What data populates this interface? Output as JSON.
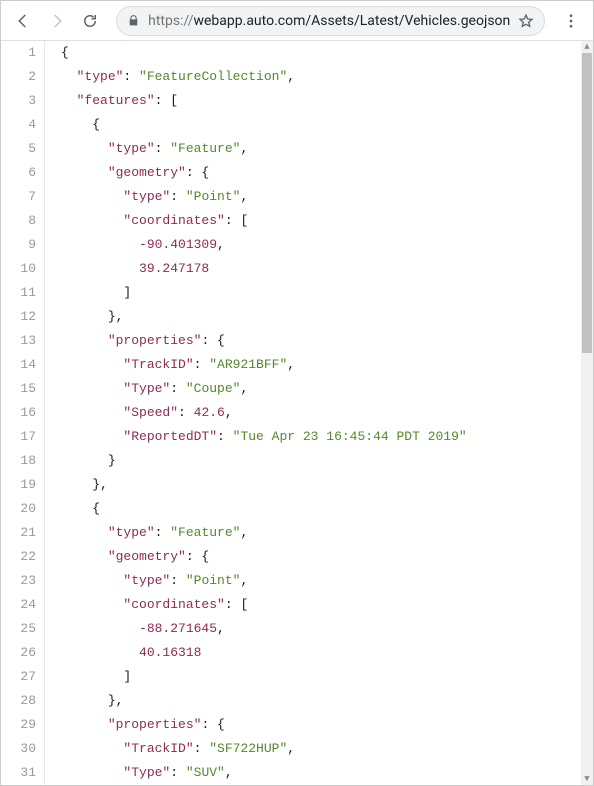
{
  "toolbar": {
    "url_proto": "https://",
    "url_rest": "webapp.auto.com/Assets/Latest/Vehicles.geojson"
  },
  "code": {
    "lines": [
      {
        "n": "1",
        "indent": 0,
        "segs": [
          {
            "c": "punc",
            "t": "{"
          }
        ]
      },
      {
        "n": "2",
        "indent": 1,
        "segs": [
          {
            "c": "key",
            "t": "\"type\""
          },
          {
            "c": "punc",
            "t": ": "
          },
          {
            "c": "str",
            "t": "\"FeatureCollection\""
          },
          {
            "c": "punc",
            "t": ","
          }
        ]
      },
      {
        "n": "3",
        "indent": 1,
        "segs": [
          {
            "c": "key",
            "t": "\"features\""
          },
          {
            "c": "punc",
            "t": ": ["
          }
        ]
      },
      {
        "n": "4",
        "indent": 2,
        "segs": [
          {
            "c": "punc",
            "t": "{"
          }
        ]
      },
      {
        "n": "5",
        "indent": 3,
        "segs": [
          {
            "c": "key",
            "t": "\"type\""
          },
          {
            "c": "punc",
            "t": ": "
          },
          {
            "c": "str",
            "t": "\"Feature\""
          },
          {
            "c": "punc",
            "t": ","
          }
        ]
      },
      {
        "n": "6",
        "indent": 3,
        "segs": [
          {
            "c": "key",
            "t": "\"geometry\""
          },
          {
            "c": "punc",
            "t": ": {"
          }
        ]
      },
      {
        "n": "7",
        "indent": 4,
        "segs": [
          {
            "c": "key",
            "t": "\"type\""
          },
          {
            "c": "punc",
            "t": ": "
          },
          {
            "c": "str",
            "t": "\"Point\""
          },
          {
            "c": "punc",
            "t": ","
          }
        ]
      },
      {
        "n": "8",
        "indent": 4,
        "segs": [
          {
            "c": "key",
            "t": "\"coordinates\""
          },
          {
            "c": "punc",
            "t": ": ["
          }
        ]
      },
      {
        "n": "9",
        "indent": 5,
        "segs": [
          {
            "c": "num",
            "t": "-90.401309"
          },
          {
            "c": "punc",
            "t": ","
          }
        ]
      },
      {
        "n": "10",
        "indent": 5,
        "segs": [
          {
            "c": "num",
            "t": "39.247178"
          }
        ]
      },
      {
        "n": "11",
        "indent": 4,
        "segs": [
          {
            "c": "punc",
            "t": "]"
          }
        ]
      },
      {
        "n": "12",
        "indent": 3,
        "segs": [
          {
            "c": "punc",
            "t": "},"
          }
        ]
      },
      {
        "n": "13",
        "indent": 3,
        "segs": [
          {
            "c": "key",
            "t": "\"properties\""
          },
          {
            "c": "punc",
            "t": ": {"
          }
        ]
      },
      {
        "n": "14",
        "indent": 4,
        "segs": [
          {
            "c": "key",
            "t": "\"TrackID\""
          },
          {
            "c": "punc",
            "t": ": "
          },
          {
            "c": "str",
            "t": "\"AR921BFF\""
          },
          {
            "c": "punc",
            "t": ","
          }
        ]
      },
      {
        "n": "15",
        "indent": 4,
        "segs": [
          {
            "c": "key",
            "t": "\"Type\""
          },
          {
            "c": "punc",
            "t": ": "
          },
          {
            "c": "str",
            "t": "\"Coupe\""
          },
          {
            "c": "punc",
            "t": ","
          }
        ]
      },
      {
        "n": "16",
        "indent": 4,
        "segs": [
          {
            "c": "key",
            "t": "\"Speed\""
          },
          {
            "c": "punc",
            "t": ": "
          },
          {
            "c": "num",
            "t": "42.6"
          },
          {
            "c": "punc",
            "t": ","
          }
        ]
      },
      {
        "n": "17",
        "indent": 4,
        "segs": [
          {
            "c": "key",
            "t": "\"ReportedDT\""
          },
          {
            "c": "punc",
            "t": ": "
          },
          {
            "c": "str",
            "t": "\"Tue Apr 23 16:45:44 PDT 2019\""
          }
        ]
      },
      {
        "n": "18",
        "indent": 3,
        "segs": [
          {
            "c": "punc",
            "t": "}"
          }
        ]
      },
      {
        "n": "19",
        "indent": 2,
        "segs": [
          {
            "c": "punc",
            "t": "},"
          }
        ]
      },
      {
        "n": "20",
        "indent": 2,
        "segs": [
          {
            "c": "punc",
            "t": "{"
          }
        ]
      },
      {
        "n": "21",
        "indent": 3,
        "segs": [
          {
            "c": "key",
            "t": "\"type\""
          },
          {
            "c": "punc",
            "t": ": "
          },
          {
            "c": "str",
            "t": "\"Feature\""
          },
          {
            "c": "punc",
            "t": ","
          }
        ]
      },
      {
        "n": "22",
        "indent": 3,
        "segs": [
          {
            "c": "key",
            "t": "\"geometry\""
          },
          {
            "c": "punc",
            "t": ": {"
          }
        ]
      },
      {
        "n": "23",
        "indent": 4,
        "segs": [
          {
            "c": "key",
            "t": "\"type\""
          },
          {
            "c": "punc",
            "t": ": "
          },
          {
            "c": "str",
            "t": "\"Point\""
          },
          {
            "c": "punc",
            "t": ","
          }
        ]
      },
      {
        "n": "24",
        "indent": 4,
        "segs": [
          {
            "c": "key",
            "t": "\"coordinates\""
          },
          {
            "c": "punc",
            "t": ": ["
          }
        ]
      },
      {
        "n": "25",
        "indent": 5,
        "segs": [
          {
            "c": "num",
            "t": "-88.271645"
          },
          {
            "c": "punc",
            "t": ","
          }
        ]
      },
      {
        "n": "26",
        "indent": 5,
        "segs": [
          {
            "c": "num",
            "t": "40.16318"
          }
        ]
      },
      {
        "n": "27",
        "indent": 4,
        "segs": [
          {
            "c": "punc",
            "t": "]"
          }
        ]
      },
      {
        "n": "28",
        "indent": 3,
        "segs": [
          {
            "c": "punc",
            "t": "},"
          }
        ]
      },
      {
        "n": "29",
        "indent": 3,
        "segs": [
          {
            "c": "key",
            "t": "\"properties\""
          },
          {
            "c": "punc",
            "t": ": {"
          }
        ]
      },
      {
        "n": "30",
        "indent": 4,
        "segs": [
          {
            "c": "key",
            "t": "\"TrackID\""
          },
          {
            "c": "punc",
            "t": ": "
          },
          {
            "c": "str",
            "t": "\"SF722HUP\""
          },
          {
            "c": "punc",
            "t": ","
          }
        ]
      },
      {
        "n": "31",
        "indent": 4,
        "segs": [
          {
            "c": "key",
            "t": "\"Type\""
          },
          {
            "c": "punc",
            "t": ": "
          },
          {
            "c": "str",
            "t": "\"SUV\""
          },
          {
            "c": "punc",
            "t": ","
          }
        ]
      }
    ]
  }
}
